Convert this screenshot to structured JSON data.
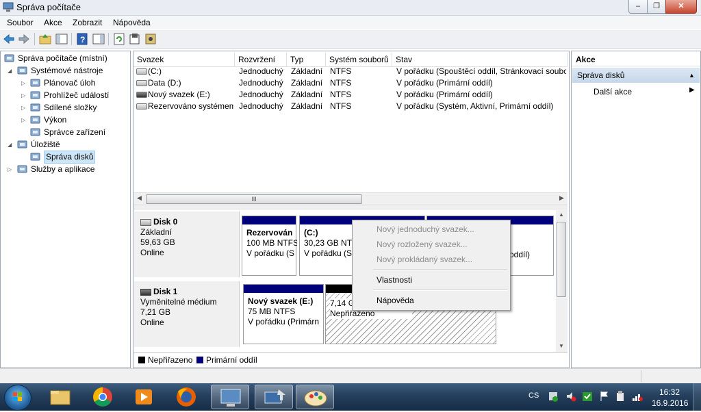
{
  "window": {
    "title": "Správa počítače",
    "controls": {
      "minimize": "–",
      "maximize": "❐",
      "close": "✕"
    }
  },
  "menu": [
    "Soubor",
    "Akce",
    "Zobrazit",
    "Nápověda"
  ],
  "tree": [
    {
      "label": "Správa počítače (místní)",
      "icon": "computer-management-icon",
      "level": 0,
      "expander": ""
    },
    {
      "label": "Systémové nástroje",
      "icon": "system-tools-icon",
      "level": 1,
      "expander": "◢"
    },
    {
      "label": "Plánovač úloh",
      "icon": "task-scheduler-icon",
      "level": 2,
      "expander": "▷"
    },
    {
      "label": "Prohlížeč událostí",
      "icon": "event-viewer-icon",
      "level": 2,
      "expander": "▷"
    },
    {
      "label": "Sdílené složky",
      "icon": "shared-folders-icon",
      "level": 2,
      "expander": "▷"
    },
    {
      "label": "Výkon",
      "icon": "performance-icon",
      "level": 2,
      "expander": "▷"
    },
    {
      "label": "Správce zařízení",
      "icon": "device-manager-icon",
      "level": 2,
      "expander": ""
    },
    {
      "label": "Úložiště",
      "icon": "storage-icon",
      "level": 1,
      "expander": "◢"
    },
    {
      "label": "Správa disků",
      "icon": "disk-management-icon",
      "level": 2,
      "expander": "",
      "selected": true
    },
    {
      "label": "Služby a aplikace",
      "icon": "services-apps-icon",
      "level": 1,
      "expander": "▷"
    }
  ],
  "volumes_table": {
    "columns": [
      "Svazek",
      "Rozvržení",
      "Typ",
      "Systém souborů",
      "Stav"
    ],
    "rows": [
      {
        "name": "(C:)",
        "layout": "Jednoduchý",
        "type": "Základní",
        "fs": "NTFS",
        "status": "V pořádku (Spouštěcí oddíl, Stránkovací soubor, Výpis stavu systému, Primární oddíl)",
        "dark": false
      },
      {
        "name": "Data (D:)",
        "layout": "Jednoduchý",
        "type": "Základní",
        "fs": "NTFS",
        "status": "V pořádku (Primární oddíl)",
        "dark": false
      },
      {
        "name": "Nový svazek (E:)",
        "layout": "Jednoduchý",
        "type": "Základní",
        "fs": "NTFS",
        "status": "V pořádku (Primární oddíl)",
        "dark": true
      },
      {
        "name": "Rezervováno systémem",
        "layout": "Jednoduchý",
        "type": "Základní",
        "fs": "NTFS",
        "status": "V pořádku (Systém, Aktivní, Primární oddíl)",
        "dark": false
      }
    ],
    "scroll_thumb_label": "III"
  },
  "disks": [
    {
      "name": "Disk 0",
      "kind": "Základní",
      "size": "59,63 GB",
      "state": "Online",
      "volumes": [
        {
          "title": "Rezervován",
          "line1": "100 MB NTFS",
          "line2": "V pořádku (S"
        },
        {
          "title": "(C:)",
          "line1": "30,23 GB NTFS",
          "line2": "V pořádku (Sp"
        },
        {
          "title": "",
          "line1": "",
          "line2": "oddíl)"
        }
      ]
    },
    {
      "name": "Disk 1",
      "kind": "Vyměnitelné médium",
      "size": "7,21 GB",
      "state": "Online",
      "volumes": [
        {
          "title": "Nový svazek  (E:)",
          "line1": "75 MB NTFS",
          "line2": "V pořádku (Primárn"
        },
        {
          "title": "",
          "line1": "7,14 GB",
          "line2": "Nepřiřazeno"
        }
      ]
    }
  ],
  "legend": [
    {
      "label": "Nepřiřazeno",
      "color": "#000000"
    },
    {
      "label": "Primární oddíl",
      "color": "#00007b"
    }
  ],
  "context_menu": {
    "items": [
      {
        "label": "Nový jednoduchý svazek...",
        "enabled": false
      },
      {
        "label": "Nový rozložený svazek...",
        "enabled": false
      },
      {
        "label": "Nový prokládaný svazek...",
        "enabled": false
      },
      {
        "label": "Vlastnosti",
        "enabled": true
      },
      {
        "label": "Nápověda",
        "enabled": true
      }
    ]
  },
  "actions": {
    "header": "Akce",
    "section": "Správa disků",
    "items": [
      "Další akce"
    ]
  },
  "taskbar": {
    "apps": [
      "file-explorer-icon",
      "chrome-icon",
      "media-player-icon",
      "firefox-icon",
      "computer-management-icon",
      "remote-desktop-icon",
      "paint-icon"
    ],
    "lang": "CS",
    "time": "16:32",
    "date": "16.9.2016"
  },
  "colors": {
    "primary_partition": "#00007b",
    "unallocated": "#000000",
    "selection": "#cde6f7"
  }
}
